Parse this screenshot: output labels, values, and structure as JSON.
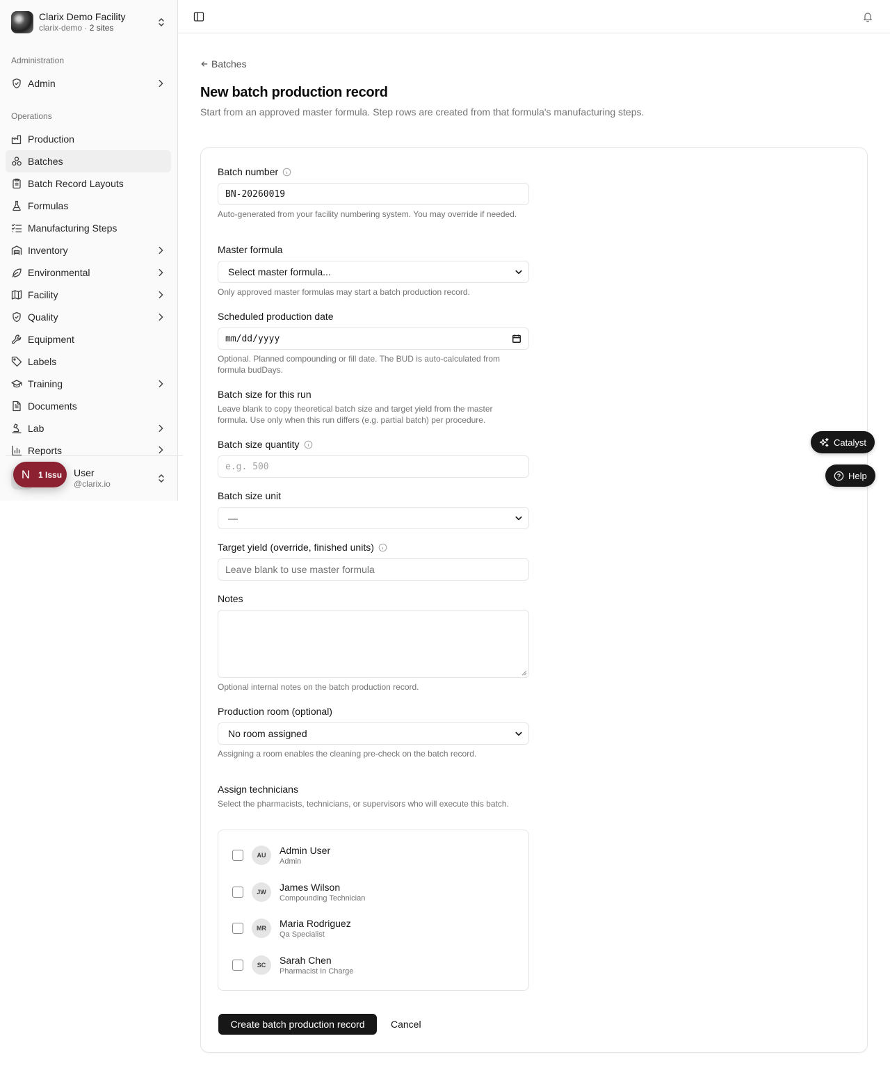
{
  "org": {
    "name": "Clarix Demo Facility",
    "slug": "clarix-demo",
    "sites": "2 sites"
  },
  "sidebar": {
    "admin_group": "Administration",
    "admin_item": "Admin",
    "ops_group": "Operations",
    "items": [
      {
        "label": "Production",
        "icon": "factory-icon"
      },
      {
        "label": "Batches",
        "icon": "batches-icon"
      },
      {
        "label": "Batch Record Layouts",
        "icon": "clipboard-icon"
      },
      {
        "label": "Formulas",
        "icon": "flask-icon"
      },
      {
        "label": "Manufacturing Steps",
        "icon": "list-checks-icon"
      },
      {
        "label": "Inventory",
        "icon": "warehouse-icon"
      },
      {
        "label": "Environmental",
        "icon": "leaf-icon"
      },
      {
        "label": "Facility",
        "icon": "map-icon"
      },
      {
        "label": "Quality",
        "icon": "shield-check-icon"
      },
      {
        "label": "Equipment",
        "icon": "wrench-icon"
      },
      {
        "label": "Labels",
        "icon": "tag-icon"
      },
      {
        "label": "Training",
        "icon": "graduation-cap-icon"
      },
      {
        "label": "Documents",
        "icon": "file-text-icon"
      },
      {
        "label": "Lab",
        "icon": "microscope-icon"
      },
      {
        "label": "Reports",
        "icon": "bar-chart-icon"
      }
    ]
  },
  "user": {
    "name": "User",
    "email": "@clarix.io"
  },
  "issue_badge": {
    "letter": "N",
    "text": "1 Issu"
  },
  "page": {
    "back": "Batches",
    "title": "New batch production record",
    "description": "Start from an approved master formula. Step rows are created from that formula's manufacturing steps."
  },
  "form": {
    "batch_number": {
      "label": "Batch number",
      "value": "BN-20260019",
      "help": "Auto-generated from your facility numbering system. You may override if needed."
    },
    "master_formula": {
      "label": "Master formula",
      "value": "Select master formula...",
      "help": "Only approved master formulas may start a batch production record."
    },
    "scheduled_date": {
      "label": "Scheduled production date",
      "placeholder": "mm/dd/yyyy",
      "help": "Optional. Planned compounding or fill date. The BUD is auto-calculated from formula budDays."
    },
    "batch_size_section": {
      "title": "Batch size for this run",
      "help": "Leave blank to copy theoretical batch size and target yield from the master formula. Use only when this run differs (e.g. partial batch) per procedure."
    },
    "batch_size_quantity": {
      "label": "Batch size quantity",
      "placeholder": "e.g. 500"
    },
    "batch_size_unit": {
      "label": "Batch size unit",
      "value": "—"
    },
    "target_yield": {
      "label": "Target yield (override, finished units)",
      "placeholder": "Leave blank to use master formula"
    },
    "notes": {
      "label": "Notes",
      "help": "Optional internal notes on the batch production record."
    },
    "production_room": {
      "label": "Production room (optional)",
      "value": "No room assigned",
      "help": "Assigning a room enables the cleaning pre-check on the batch record."
    },
    "technicians": {
      "title": "Assign technicians",
      "help": "Select the pharmacists, technicians, or supervisors who will execute this batch.",
      "list": [
        {
          "initials": "AU",
          "name": "Admin User",
          "role": "Admin"
        },
        {
          "initials": "JW",
          "name": "James Wilson",
          "role": "Compounding Technician"
        },
        {
          "initials": "MR",
          "name": "Maria Rodriguez",
          "role": "Qa Specialist"
        },
        {
          "initials": "SC",
          "name": "Sarah Chen",
          "role": "Pharmacist In Charge"
        }
      ]
    },
    "submit": "Create batch production record",
    "cancel": "Cancel"
  },
  "floating": {
    "catalyst": "Catalyst",
    "help": "Help"
  }
}
